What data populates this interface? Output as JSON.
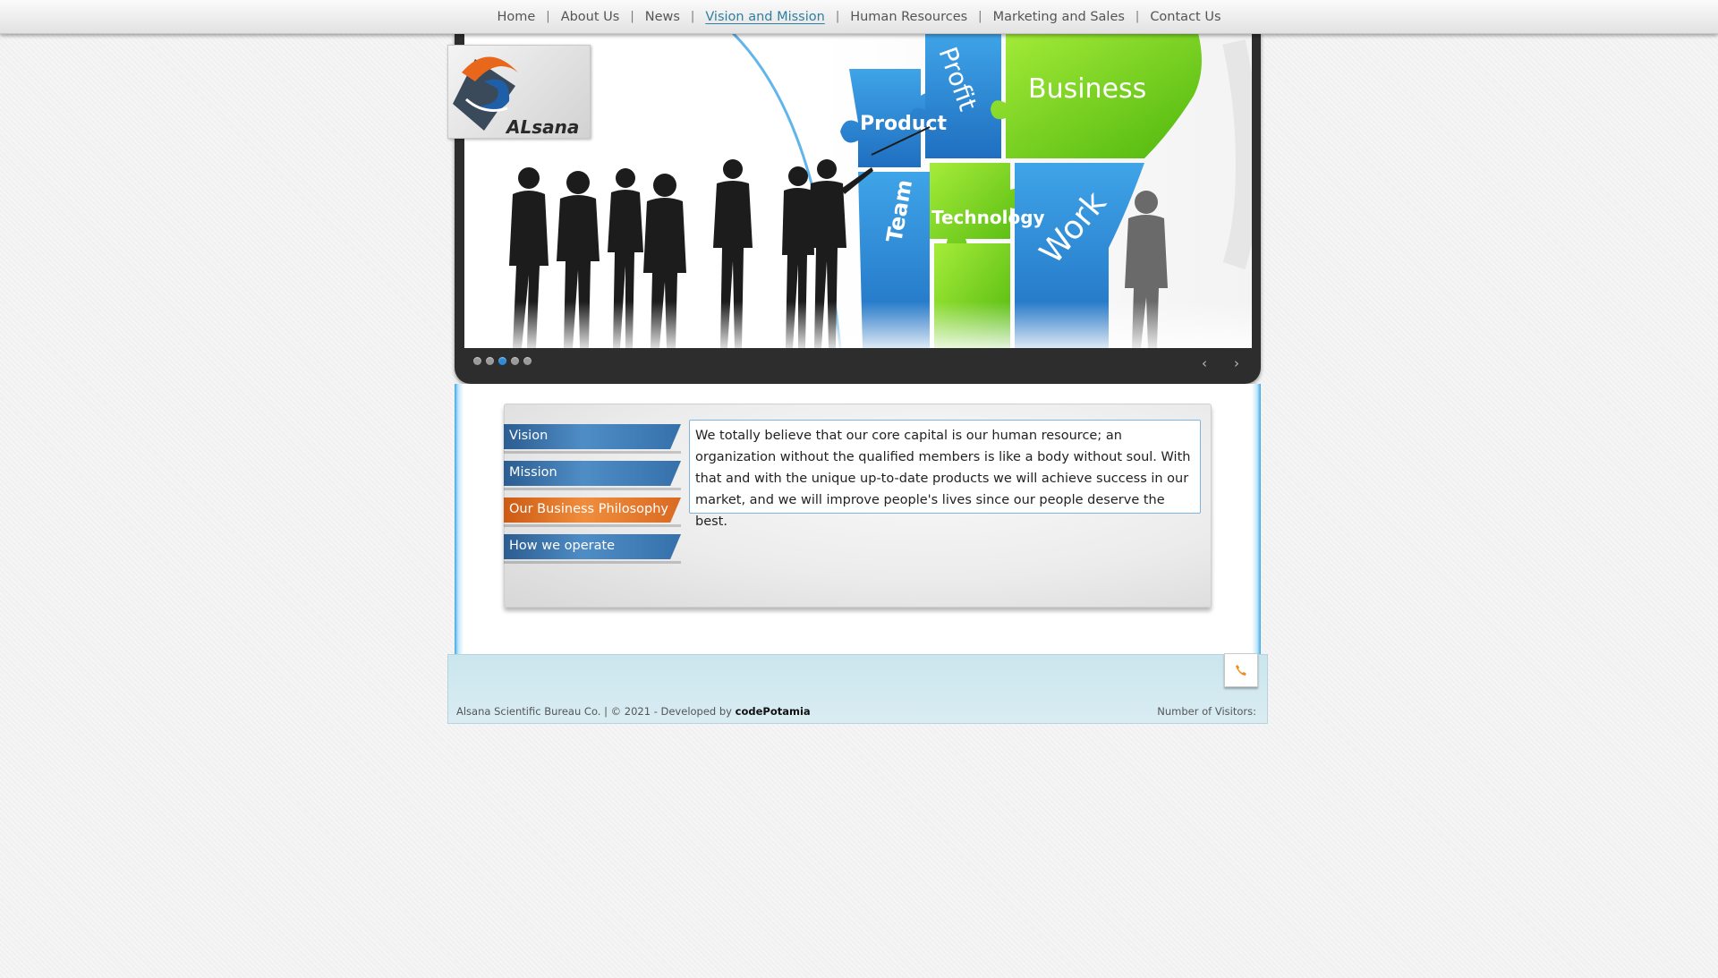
{
  "nav": {
    "items": [
      {
        "label": "Home",
        "active": false
      },
      {
        "label": "About Us",
        "active": false
      },
      {
        "label": "News",
        "active": false
      },
      {
        "label": "Vision and Mission",
        "active": true
      },
      {
        "label": "Human Resources",
        "active": false
      },
      {
        "label": "Marketing and Sales",
        "active": false
      },
      {
        "label": "Contact Us",
        "active": false
      }
    ],
    "separator": "|"
  },
  "logo": {
    "text": "ALsana"
  },
  "slider": {
    "puzzle_words": [
      "Product",
      "Profit",
      "Business",
      "Team",
      "Technology",
      "Work"
    ],
    "slide_count": 5,
    "active_slide": 3,
    "prev_icon": "chevron-left-icon",
    "next_icon": "chevron-right-icon"
  },
  "vision": {
    "tabs": [
      {
        "label": "Vision",
        "active": false
      },
      {
        "label": "Mission",
        "active": false
      },
      {
        "label": "Our Business Philosophy",
        "active": true
      },
      {
        "label": "How we operate",
        "active": false
      }
    ],
    "content": "We totally believe that our core capital is our human resource; an organization without the qualified members is like a body without soul. With that and with the unique up-to-date products we will achieve success in our market, and we will improve people's lives since our people deserve the best."
  },
  "footer": {
    "copyright": "Alsana Scientific Bureau Co. | © 2021 - Developed by",
    "developer": "codePotamia",
    "visitors_label": "Number of Visitors:",
    "phone_icon": "phone-icon"
  },
  "colors": {
    "accent_blue": "#2f7fa0",
    "tab_blue": "#3570aa",
    "tab_orange": "#e0772b",
    "frame_dark": "#2d2d2d",
    "phone_orange": "#f08a1c"
  }
}
